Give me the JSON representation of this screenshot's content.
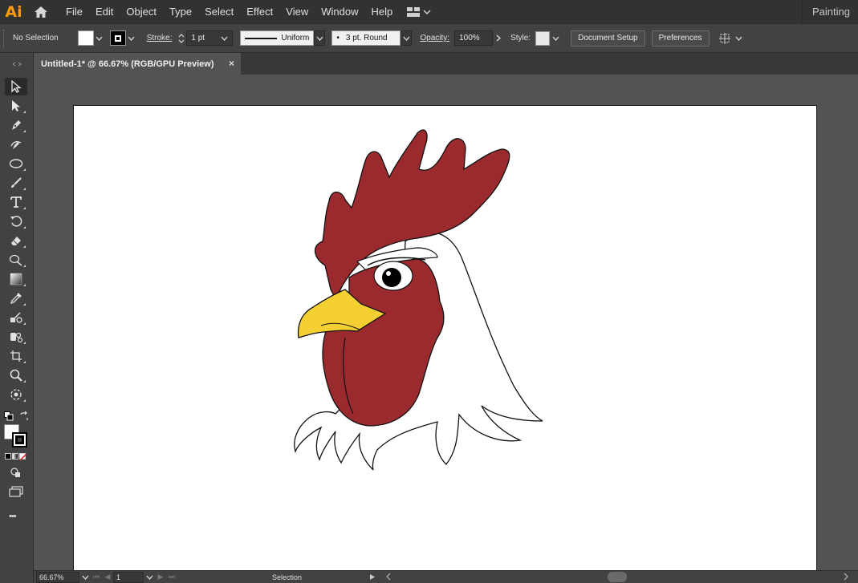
{
  "app": {
    "logo": "Ai",
    "workspace": "Painting"
  },
  "menu": {
    "items": [
      "File",
      "Edit",
      "Object",
      "Type",
      "Select",
      "Effect",
      "View",
      "Window",
      "Help"
    ]
  },
  "control_bar": {
    "selection": "No Selection",
    "stroke_label": "Stroke:",
    "stroke_weight": "1 pt",
    "profile": "Uniform",
    "brush": "3 pt. Round",
    "opacity_label": "Opacity:",
    "opacity_value": "100%",
    "style_label": "Style:",
    "document_setup": "Document Setup",
    "preferences": "Preferences"
  },
  "document": {
    "tab_title": "Untitled-1* @ 66.67% (RGB/GPU Preview)",
    "close": "×"
  },
  "toolbar": {
    "tools": [
      "selection-tool",
      "direct-selection-tool",
      "pen-tool",
      "curvature-tool",
      "ellipse-tool",
      "paintbrush-tool",
      "type-tool",
      "rotate-tool",
      "eraser-tool",
      "shape-builder-tool",
      "gradient-tool",
      "eyedropper-tool",
      "blend-tool",
      "symbol-sprayer-tool",
      "artboard-tool",
      "zoom-tool",
      "puppet-warp-tool"
    ],
    "more": "•••"
  },
  "status_bar": {
    "zoom": "66.67%",
    "page": "1",
    "mode": "Selection"
  },
  "artwork": {
    "comb_color": "#9b2a2e",
    "beak_color": "#f5d033",
    "outline_color": "#111111"
  }
}
